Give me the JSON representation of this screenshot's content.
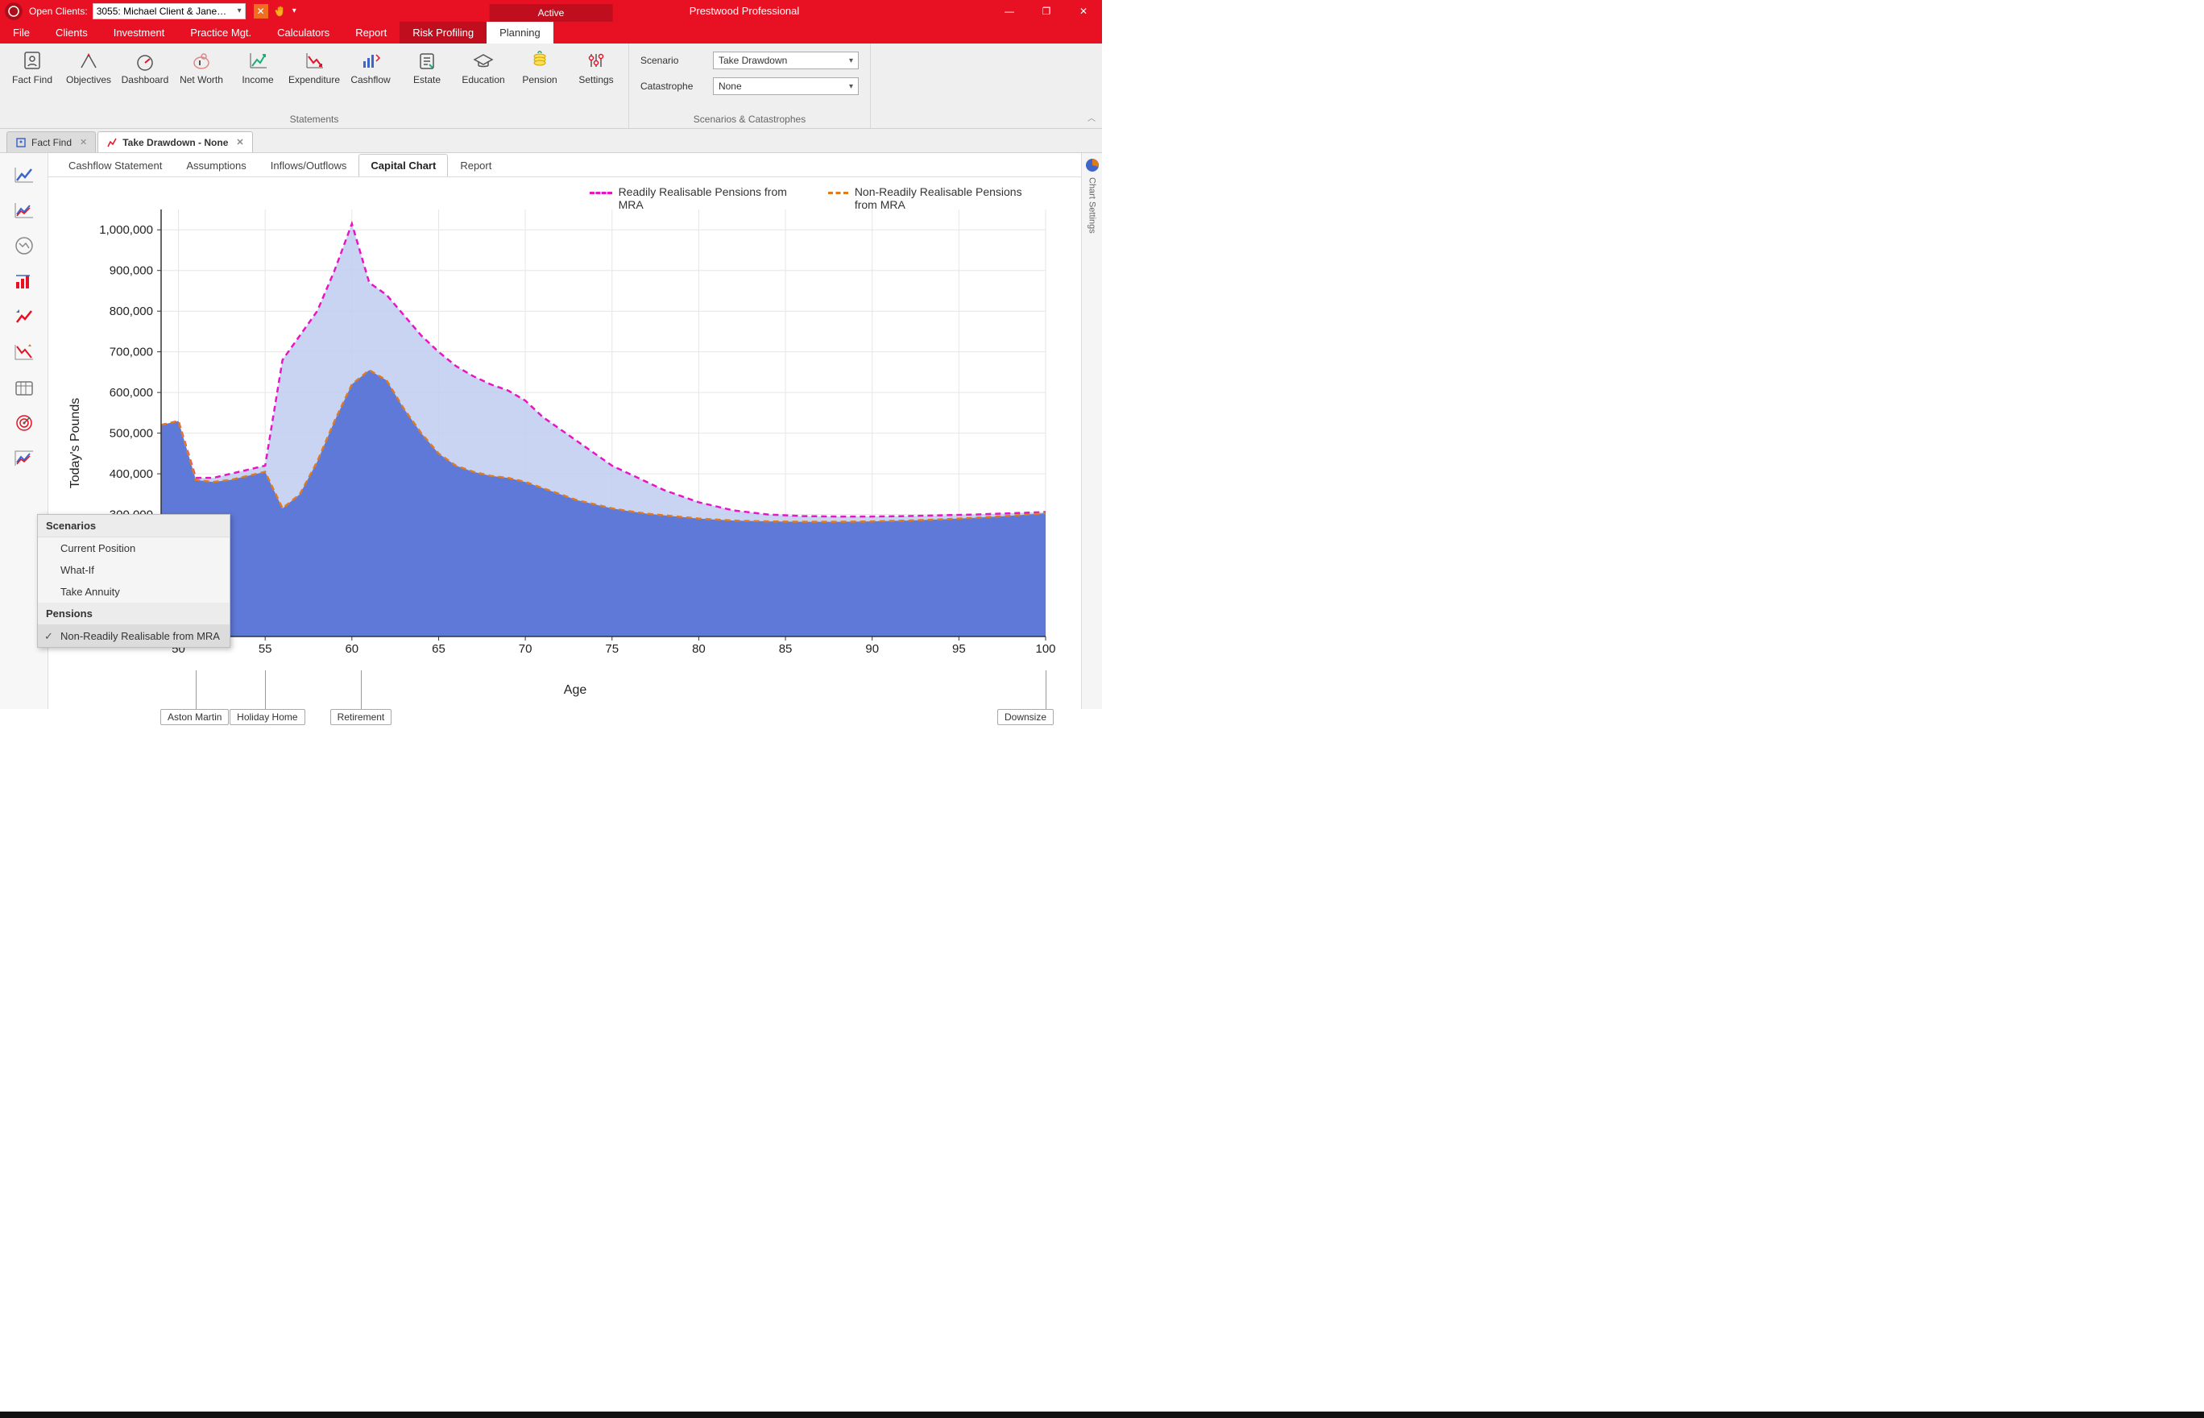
{
  "titlebar": {
    "open_clients_label": "Open Clients:",
    "client_value": "3055: Michael Client & Jane…",
    "active_label": "Active",
    "app_title": "Prestwood Professional"
  },
  "menubar": {
    "items": [
      "File",
      "Clients",
      "Investment",
      "Practice Mgt.",
      "Calculators",
      "Report",
      "Risk Profiling",
      "Planning"
    ],
    "selected": "Planning",
    "highlighted": "Risk Profiling"
  },
  "ribbon": {
    "statements_label": "Statements",
    "scenarios_label": "Scenarios & Catastrophes",
    "buttons": [
      "Fact Find",
      "Objectives",
      "Dashboard",
      "Net Worth",
      "Income",
      "Expenditure",
      "Cashflow",
      "Estate",
      "Education",
      "Pension",
      "Settings"
    ],
    "scenario_label": "Scenario",
    "scenario_value": "Take Drawdown",
    "catastrophe_label": "Catastrophe",
    "catastrophe_value": "None"
  },
  "doc_tabs": {
    "tabs": [
      {
        "label": "Fact Find",
        "active": false
      },
      {
        "label": "Take Drawdown - None",
        "active": true
      }
    ]
  },
  "sub_tabs": {
    "items": [
      "Cashflow Statement",
      "Assumptions",
      "Inflows/Outflows",
      "Capital Chart",
      "Report"
    ],
    "active": "Capital Chart"
  },
  "right_rail": {
    "label": "Chart Settings"
  },
  "popup": {
    "group1": "Scenarios",
    "items1": [
      "Current Position",
      "What-If",
      "Take Annuity"
    ],
    "group2": "Pensions",
    "items2": [
      "Non-Readily Realisable from MRA"
    ],
    "checked": "Non-Readily Realisable from MRA"
  },
  "chart_data": {
    "type": "area",
    "xlabel": "Age",
    "ylabel": "Today's Pounds",
    "x_ticks": [
      50,
      55,
      60,
      65,
      70,
      75,
      80,
      85,
      90,
      95,
      100
    ],
    "y_ticks": [
      300000,
      400000,
      500000,
      600000,
      700000,
      800000,
      900000,
      1000000
    ],
    "y_tick_labels": [
      "300,000",
      "400,000",
      "500,000",
      "600,000",
      "700,000",
      "800,000",
      "900,000",
      "1,000,000"
    ],
    "xlim": [
      49,
      100
    ],
    "ylim": [
      0,
      1050000
    ],
    "series": [
      {
        "name": "Readily Realisable Pensions from MRA",
        "color": "#e815c5",
        "fill": "#c0cdf0",
        "dash": true,
        "x": [
          49,
          50,
          51,
          52,
          53,
          54,
          55,
          56,
          57,
          58,
          59,
          60,
          61,
          62,
          63,
          64,
          65,
          66,
          67,
          68,
          69,
          70,
          71,
          72,
          73,
          74,
          75,
          76,
          77,
          78,
          79,
          80,
          82,
          84,
          86,
          88,
          90,
          92,
          94,
          96,
          98,
          100
        ],
        "y": [
          520000,
          530000,
          390000,
          390000,
          400000,
          410000,
          420000,
          680000,
          740000,
          800000,
          900000,
          1015000,
          870000,
          840000,
          790000,
          740000,
          700000,
          665000,
          640000,
          620000,
          605000,
          580000,
          540000,
          510000,
          480000,
          450000,
          420000,
          400000,
          380000,
          360000,
          345000,
          330000,
          310000,
          300000,
          296000,
          295000,
          295000,
          296000,
          298000,
          300000,
          303000,
          306000
        ]
      },
      {
        "name": "Non-Readily Realisable Pensions from MRA",
        "color": "#e07a1f",
        "fill": "#5a74d6",
        "dash": true,
        "x": [
          49,
          50,
          51,
          52,
          53,
          54,
          55,
          56,
          57,
          58,
          59,
          60,
          61,
          62,
          63,
          64,
          65,
          66,
          67,
          68,
          69,
          70,
          71,
          72,
          73,
          74,
          75,
          76,
          77,
          78,
          79,
          80,
          82,
          84,
          86,
          88,
          90,
          92,
          94,
          96,
          98,
          100
        ],
        "y": [
          520000,
          530000,
          385000,
          380000,
          385000,
          395000,
          405000,
          315000,
          350000,
          430000,
          530000,
          620000,
          655000,
          630000,
          560000,
          500000,
          450000,
          420000,
          405000,
          395000,
          390000,
          380000,
          365000,
          350000,
          335000,
          325000,
          315000,
          308000,
          302000,
          298000,
          294000,
          290000,
          285000,
          283000,
          282000,
          282000,
          283000,
          285000,
          288000,
          292000,
          297000,
          303000
        ]
      }
    ],
    "annotations": [
      {
        "x": 51,
        "label": "Aston Martin"
      },
      {
        "x": 55,
        "label": "Holiday Home"
      },
      {
        "x": 60.5,
        "label": "Retirement"
      },
      {
        "x": 100,
        "label": "Downsize"
      }
    ],
    "legend": [
      {
        "name": "Readily Realisable Pensions from MRA",
        "color": "#e815c5"
      },
      {
        "name": "Non-Readily Realisable Pensions from MRA",
        "color": "#e07a1f"
      }
    ]
  }
}
